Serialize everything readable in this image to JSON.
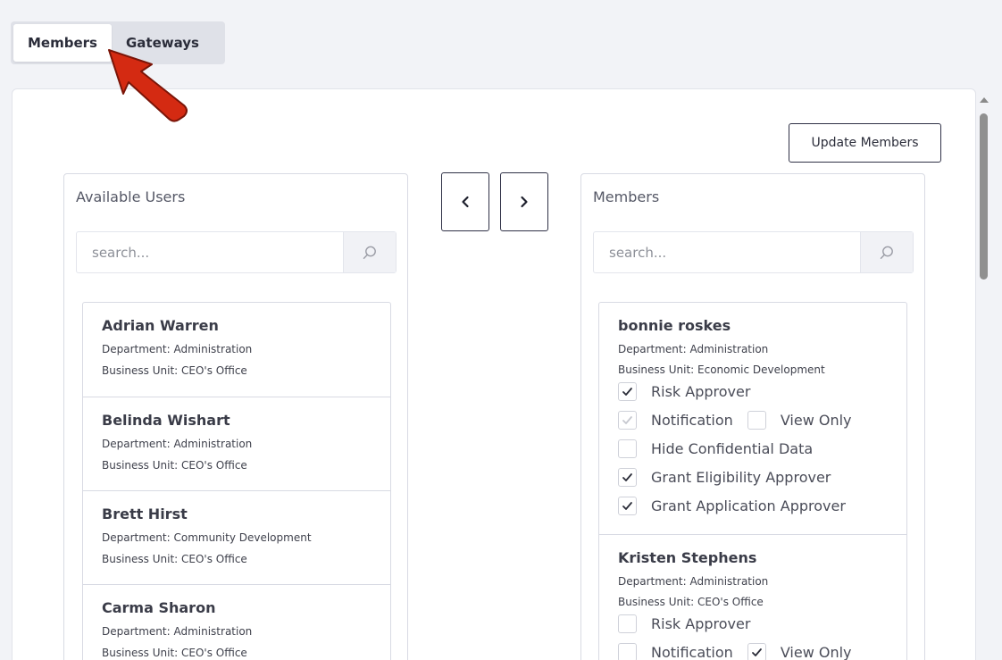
{
  "tabs": [
    {
      "label": "Members",
      "active": true
    },
    {
      "label": "Gateways",
      "active": false
    }
  ],
  "toolbar": {
    "update_label": "Update Members"
  },
  "available": {
    "title": "Available Users",
    "search_placeholder": "search...",
    "users": [
      {
        "name": "Adrian Warren",
        "department": "Department: Administration",
        "business_unit": "Business Unit: CEO's Office"
      },
      {
        "name": "Belinda Wishart",
        "department": "Department: Administration",
        "business_unit": "Business Unit: CEO's Office"
      },
      {
        "name": "Brett Hirst",
        "department": "Department: Community Development",
        "business_unit": "Business Unit: CEO's Office"
      },
      {
        "name": "Carma Sharon",
        "department": "Department: Administration",
        "business_unit": "Business Unit: CEO's Office"
      }
    ]
  },
  "members": {
    "title": "Members",
    "search_placeholder": "search...",
    "users": [
      {
        "name": "bonnie roskes",
        "department": "Department: Administration",
        "business_unit": "Business Unit: Economic Development",
        "risk_approver": "Risk Approver",
        "notification": "Notification",
        "view_only": "View Only",
        "hide_confidential": "Hide Confidential Data",
        "grant_eligibility": "Grant Eligibility Approver",
        "grant_application": "Grant Application Approver"
      },
      {
        "name": "Kristen Stephens",
        "department": "Department: Administration",
        "business_unit": "Business Unit: CEO's Office",
        "risk_approver": "Risk Approver",
        "notification": "Notification",
        "view_only": "View Only"
      }
    ]
  },
  "colors": {
    "accent_border": "#2f3146",
    "annotation_arrow": "#d42a12"
  },
  "icons": {
    "search": "search-icon",
    "prev": "chevron-left-icon",
    "next": "chevron-right-icon",
    "check": "check-icon",
    "annotation": "red-arrow-icon"
  }
}
